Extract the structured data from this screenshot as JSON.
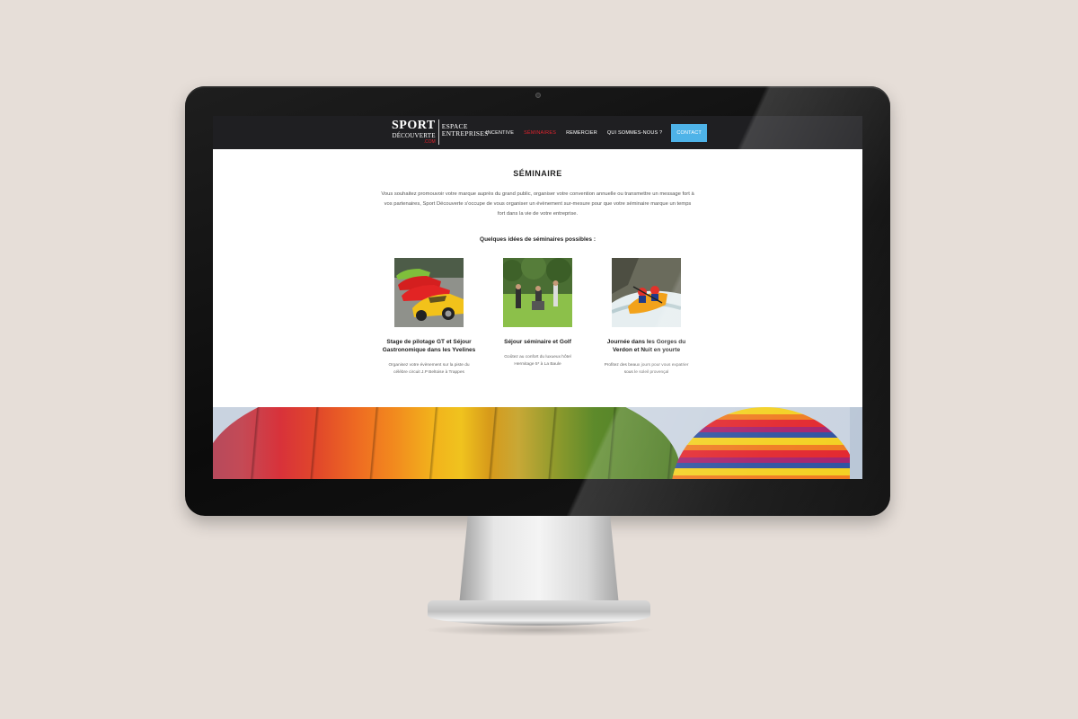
{
  "logo": {
    "sport": "SPORT",
    "decouverte": "DÉCOUVERTE",
    "tld": ".COM",
    "espace": "ESPACE",
    "entreprises": "ENTREPRISES"
  },
  "nav": {
    "items": [
      {
        "label": "INCENTIVE",
        "active": false
      },
      {
        "label": "SÉMINAIRES",
        "active": true
      },
      {
        "label": "REMERCIER",
        "active": false
      },
      {
        "label": "QUI SOMMES-NOUS ?",
        "active": false
      }
    ],
    "contact": "CONTACT",
    "active_color": "#e0232d",
    "contact_color": "#4eb3e8"
  },
  "main": {
    "title": "SÉMINAIRE",
    "intro": "Vous souhaitez promouvoir votre marque auprès du grand public, organiser votre convention annuelle ou transmettre un message fort à vos partenaires, Sport Découverte s'occupe de vous organiser un évènement sur-mesure pour que votre séminaire marque un temps fort dans la vie de votre entreprise.",
    "ideas_title": "Quelques idées de séminaires possibles :"
  },
  "cards": [
    {
      "title": "Stage de pilotage GT et Séjour Gastronomique dans les Yvelines",
      "desc": "Organisez votre évènement sur la piste du célèbre circuit J.P Beltoise à Trappes",
      "image": "sports-cars"
    },
    {
      "title": "Séjour séminaire et Golf",
      "desc": "Goûtez au confort du luxueux hôtel Hermitage 5* à La Baule",
      "image": "golf-players"
    },
    {
      "title": "Journée dans les Gorges du Verdon et Nuit en yourte",
      "desc": "Profitez des beaux jours pour vous expatrier sous le soleil provençal",
      "image": "rafting"
    }
  ],
  "banner": {
    "image": "hot-air-balloons"
  }
}
